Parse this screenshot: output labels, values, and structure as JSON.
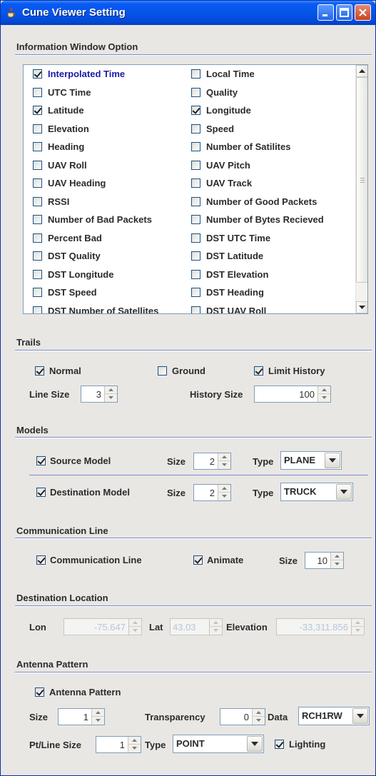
{
  "window": {
    "title": "Cune Viewer Setting",
    "title_icon": "java-cup-icon",
    "accent": "#0655e8"
  },
  "info_window": {
    "section_title": "Information Window Option",
    "items": [
      {
        "label": "Interpolated Time",
        "checked": true
      },
      {
        "label": "Local Time",
        "checked": false
      },
      {
        "label": "UTC Time",
        "checked": false
      },
      {
        "label": "Quality",
        "checked": false
      },
      {
        "label": "Latitude",
        "checked": true
      },
      {
        "label": "Longitude",
        "checked": true
      },
      {
        "label": "Elevation",
        "checked": false
      },
      {
        "label": "Speed",
        "checked": false
      },
      {
        "label": "Heading",
        "checked": false
      },
      {
        "label": "Number of Satilites",
        "checked": false
      },
      {
        "label": "UAV Roll",
        "checked": false
      },
      {
        "label": "UAV Pitch",
        "checked": false
      },
      {
        "label": "UAV Heading",
        "checked": false
      },
      {
        "label": "UAV Track",
        "checked": false
      },
      {
        "label": "RSSI",
        "checked": false
      },
      {
        "label": "Number of Good Packets",
        "checked": false
      },
      {
        "label": "Number of Bad Packets",
        "checked": false
      },
      {
        "label": "Number of Bytes Recieved",
        "checked": false
      },
      {
        "label": "Percent Bad",
        "checked": false
      },
      {
        "label": "DST UTC Time",
        "checked": false
      },
      {
        "label": "DST Quality",
        "checked": false
      },
      {
        "label": "DST Latitude",
        "checked": false
      },
      {
        "label": "DST Longitude",
        "checked": false
      },
      {
        "label": "DST Elevation",
        "checked": false
      },
      {
        "label": "DST Speed",
        "checked": false
      },
      {
        "label": "DST Heading",
        "checked": false
      },
      {
        "label": "DST Number of Satellites",
        "checked": false
      },
      {
        "label": "DST UAV Roll",
        "checked": false
      }
    ]
  },
  "trails": {
    "section_title": "Trails",
    "normal": {
      "label": "Normal",
      "checked": true
    },
    "ground": {
      "label": "Ground",
      "checked": false
    },
    "limit_history": {
      "label": "Limit History",
      "checked": true
    },
    "line_size_label": "Line Size",
    "line_size": "3",
    "history_size_label": "History Size",
    "history_size": "100"
  },
  "models": {
    "section_title": "Models",
    "size_label": "Size",
    "type_label": "Type",
    "source": {
      "label": "Source Model",
      "checked": true,
      "size": "2",
      "type": "PLANE"
    },
    "destination": {
      "label": "Destination Model",
      "checked": true,
      "size": "2",
      "type": "TRUCK"
    }
  },
  "communication": {
    "section_title": "Communication Line",
    "line": {
      "label": "Communication Line",
      "checked": true
    },
    "animate": {
      "label": "Animate",
      "checked": true
    },
    "size_label": "Size",
    "size": "10"
  },
  "destination_location": {
    "section_title": "Destination Location",
    "lon_label": "Lon",
    "lon": "-75.647",
    "lat_label": "Lat",
    "lat": "43.03",
    "elevation_label": "Elevation",
    "elevation": "-33,311.856"
  },
  "antenna": {
    "section_title": "Antenna Pattern",
    "pattern": {
      "label": "Antenna Pattern",
      "checked": true
    },
    "size_label": "Size",
    "size": "1",
    "transparency_label": "Transparency",
    "transparency": "0",
    "data_label": "Data",
    "data": "RCH1RW",
    "pt_line_size_label": "Pt/Line Size",
    "pt_line_size": "1",
    "type_label": "Type",
    "type": "POINT",
    "lighting": {
      "label": "Lighting",
      "checked": true
    }
  }
}
